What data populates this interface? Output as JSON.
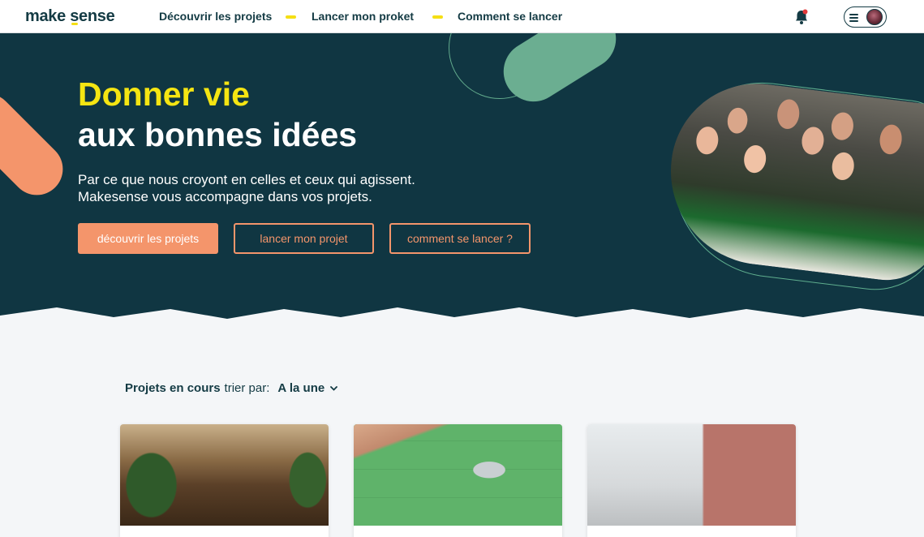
{
  "brand": {
    "name": "make sense",
    "accent": "#f5df14",
    "primary": "#103642",
    "orange": "#f4956b",
    "green": "#6bae91"
  },
  "nav": {
    "links": [
      "Découvrir les projets",
      "Lancer mon proket",
      "Comment se lancer"
    ],
    "icons": {
      "notifications": "bell-icon",
      "menu": "hamburger-icon"
    }
  },
  "hero": {
    "title_line1": "Donner vie",
    "title_line2": "aux bonnes idées",
    "subtitle_line1": "Par ce que nous croyont en celles et ceux qui agissent.",
    "subtitle_line2": "Makesense vous accompagne dans vos projets.",
    "buttons": [
      "découvrir les projets",
      "lancer mon projet",
      "comment se lancer ?"
    ]
  },
  "projects": {
    "title": "Projets en cours",
    "sort_label": "trier par:",
    "sort_value": "A la une",
    "cards": [
      {
        "title": ""
      },
      {
        "title": ""
      },
      {
        "title": ""
      }
    ]
  }
}
